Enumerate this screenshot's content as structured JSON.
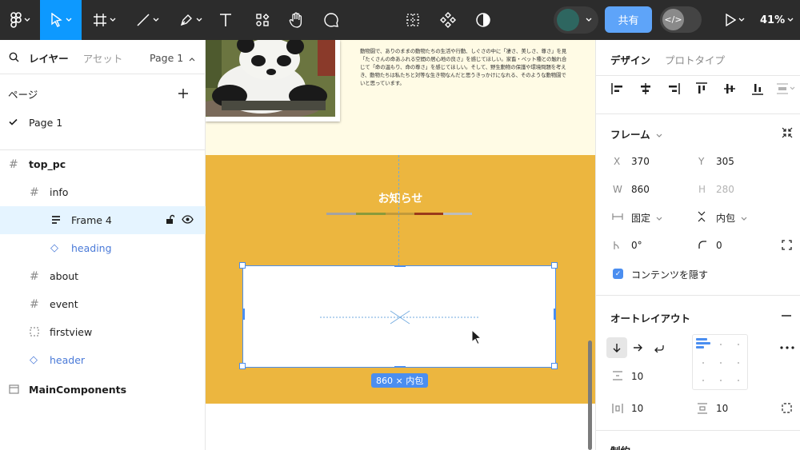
{
  "toolbar": {
    "share_label": "共有",
    "devmode_label": "</>",
    "zoom": "41%"
  },
  "left_panel": {
    "tabs": {
      "layers": "レイヤー",
      "assets": "アセット",
      "page_selector": "Page 1"
    },
    "pages_heading": "ページ",
    "current_page": "Page 1",
    "layers": [
      {
        "label": "top_pc",
        "icon": "frame-icon"
      },
      {
        "label": "info",
        "icon": "frame-icon"
      },
      {
        "label": "Frame 4",
        "icon": "autolayout-vertical-icon"
      },
      {
        "label": "heading",
        "icon": "instance-icon"
      },
      {
        "label": "about",
        "icon": "frame-icon"
      },
      {
        "label": "event",
        "icon": "frame-icon"
      },
      {
        "label": "firstview",
        "icon": "section-icon"
      },
      {
        "label": "header",
        "icon": "instance-icon"
      },
      {
        "label": "MainComponents",
        "icon": "page-icon"
      }
    ]
  },
  "canvas": {
    "blurb_lines": [
      "動物園で、ありのままの動物たちの生活や行動、しぐさの中に「凄さ、美しさ、尊さ」を見",
      "「たくさんの命あふれる空間の居心地の良さ」を感じてほしい。家畜・ペット種との触れ合",
      "じて「命の温もり、命の尊さ」を感じてほしい。そして、野生動物の保護や環境問題を考え",
      "き、動物たちは私たちと対等な生き物なんだと思うきっかけになれる、そのような動物園で",
      "いと思っています。"
    ],
    "section_title": "お知らせ",
    "underline_colors": [
      "#a3a3a3",
      "#8a9a3a",
      "#c29a3a",
      "#9a3a1a",
      "#bdbdbd"
    ],
    "size_badge": "860 × 内包"
  },
  "right_panel": {
    "tabs": {
      "design": "デザイン",
      "prototype": "プロトタイプ"
    },
    "frame": {
      "title": "フレーム",
      "x_label": "X",
      "x": "370",
      "y_label": "Y",
      "y": "305",
      "w_label": "W",
      "w": "860",
      "h_label": "H",
      "h": "280",
      "width_mode": "固定",
      "height_mode": "内包",
      "rotation": "0°",
      "radius": "0",
      "clip_label": "コンテンツを隠す"
    },
    "autolayout": {
      "title": "オートレイアウト",
      "gap": "10",
      "padding_h": "10",
      "padding_v": "10"
    },
    "next_section": "制約"
  }
}
